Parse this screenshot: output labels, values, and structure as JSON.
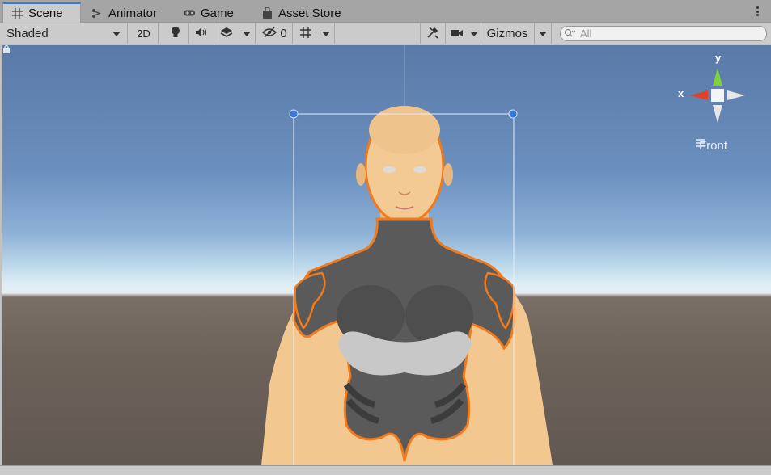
{
  "tabs": [
    {
      "label": "Scene",
      "icon": "scene-grid-icon"
    },
    {
      "label": "Animator",
      "icon": "animator-icon"
    },
    {
      "label": "Game",
      "icon": "gamepad-icon"
    },
    {
      "label": "Asset Store",
      "icon": "shopping-bag-icon"
    }
  ],
  "toolbar": {
    "shading_mode": "Shaded",
    "mode_2d": "2D",
    "hidden_count": "0",
    "gizmos_label": "Gizmos",
    "search_placeholder": "All"
  },
  "viewport": {
    "orientation_label": "Front",
    "axis_labels": {
      "x": "x",
      "y": "y"
    },
    "selection_outline_color": "#f07a1c",
    "sky_color": "#6b8fbe",
    "ground_color": "#6c625a"
  },
  "colors": {
    "active_tab_accent": "#3a79d8",
    "gizmo_x": "#e0402a",
    "gizmo_y": "#7ed23a"
  }
}
